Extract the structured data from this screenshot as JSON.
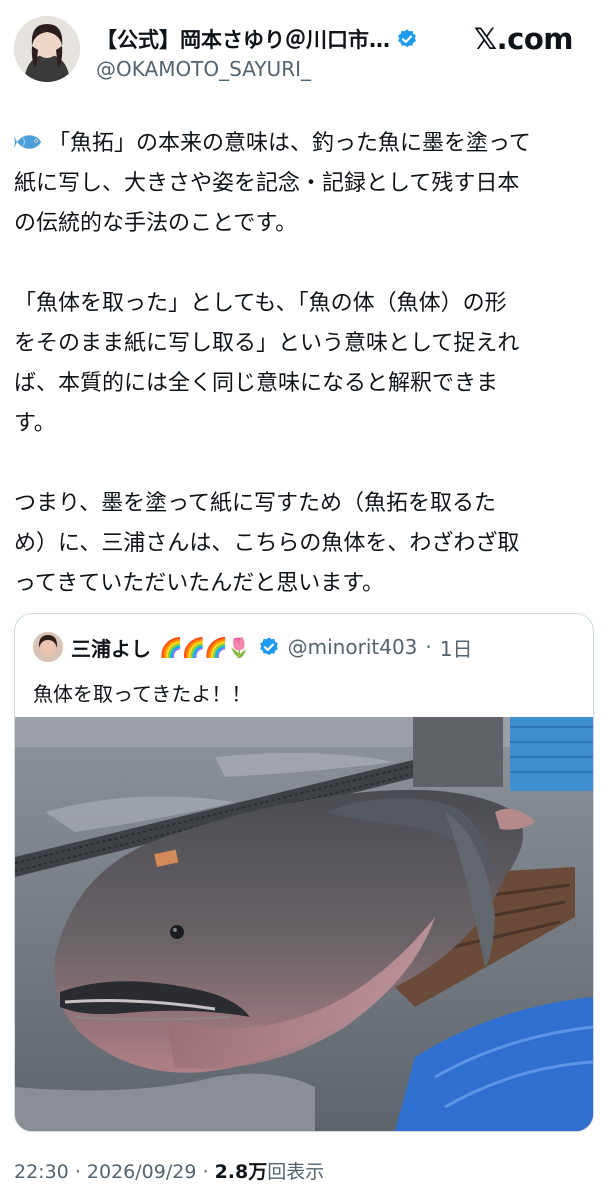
{
  "header": {
    "display_name": "【公式】岡本さゆり＠川口市…",
    "handle": "@OKAMOTO_SAYURI_",
    "brand": "𝕏.com"
  },
  "post": {
    "lines": [
      "「魚拓」の本来の意味は、釣った魚に墨を塗って",
      "紙に写し、大きさや姿を記念・記録として残す日本",
      "の伝統的な手法のことです。",
      "",
      "「魚体を取った」としても、「魚の体（魚体）の形",
      "をそのまま紙に写し取る」という意味として捉えれ",
      "ば、本質的には全く同じ意味になると解釈できま",
      "す。",
      "",
      "つまり、墨を塗って紙に写すため（魚拓を取るた",
      "め）に、三浦さんは、こちらの魚体を、わざわざ取",
      "ってきていただいたんだと思います。"
    ]
  },
  "quote": {
    "display_name": "三浦よし",
    "emojis": "🌈🌈🌈🌷",
    "handle": "@minorit403",
    "time": "1日",
    "text": "魚体を取ってきたよ！！"
  },
  "meta": {
    "time": "22:30",
    "date": "2026/09/29",
    "views": "2.8万",
    "views_label": "回表示"
  },
  "colors": {
    "text": "#0f1419",
    "secondary": "#536471",
    "verified": "#1d9bf0",
    "border": "#cfd9de"
  }
}
